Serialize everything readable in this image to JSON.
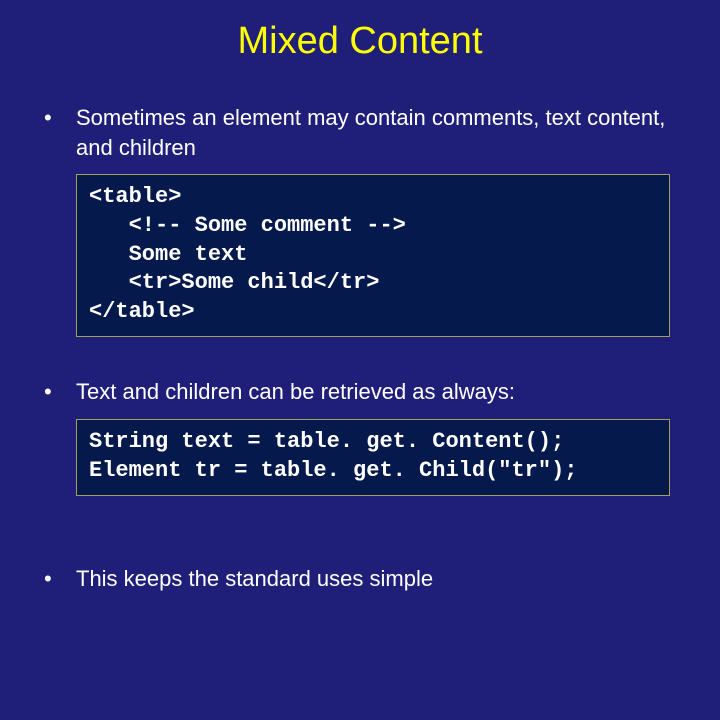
{
  "title": "Mixed Content",
  "bullets": {
    "b1": "Sometimes an element may contain comments, text content, and children",
    "b2": "Text and children can be retrieved as always:",
    "b3": "This keeps the standard uses simple"
  },
  "code1": {
    "l1": "<table>",
    "l2": "   <!-- Some comment -->",
    "l3": "   Some text",
    "l4": "   <tr>Some child</tr>",
    "l5": "</table>"
  },
  "code2": {
    "l1": "String text = table. get. Content();",
    "l2": "Element tr = table. get. Child(\"tr\");"
  }
}
